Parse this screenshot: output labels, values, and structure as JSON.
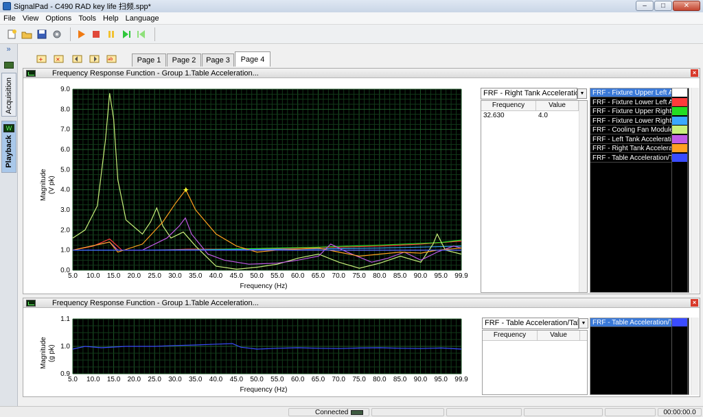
{
  "window": {
    "title": "SignalPad - C490 RAD key life 扫频.spp*",
    "min": "–",
    "max": "□",
    "close": "✕"
  },
  "menu": [
    "File",
    "View",
    "Options",
    "Tools",
    "Help",
    "Language"
  ],
  "toolbar": {
    "icons": [
      "new-icon",
      "open-icon",
      "save-icon",
      "settings-icon",
      "play-icon",
      "stop-icon",
      "pause-icon",
      "step-forward-icon",
      "step-back-icon"
    ]
  },
  "sidebar": {
    "chevron": "»",
    "tabs": [
      {
        "label": "Acquisition",
        "active": false
      },
      {
        "label": "Playback",
        "active": true
      }
    ]
  },
  "page_tabs": [
    "Page 1",
    "Page 2",
    "Page 3",
    "Page 4"
  ],
  "active_page": "Page 4",
  "panels": [
    {
      "title": "Frequency Response Function - Group 1.Table Acceleration...",
      "xlabel": "Frequency (Hz)",
      "ylabel": "Magnitude",
      "yunit": "(V pk)",
      "selector": "FRF - Right Tank Acceleration/",
      "table": {
        "headers": [
          "Frequency",
          "Value"
        ],
        "rows": [
          [
            "32.630",
            "4.0"
          ]
        ]
      },
      "legend": [
        {
          "label": "FRF - Fixture Upper Left A",
          "color": "#ffffff",
          "selected": true
        },
        {
          "label": "FRF - Fixture Lower Left A",
          "color": "#ff3b3b"
        },
        {
          "label": "FRF - Fixture Upper Right A",
          "color": "#22dd22"
        },
        {
          "label": "FRF - Fixture Lower Right",
          "color": "#3aa8ff"
        },
        {
          "label": "FRF - Cooling Fan Module A",
          "color": "#c8f07a"
        },
        {
          "label": "FRF - Left Tank Acceleratio",
          "color": "#c05ae6"
        },
        {
          "label": "FRF - Right Tank Accelerati",
          "color": "#ffa020"
        },
        {
          "label": "FRF - Table Acceleration/T",
          "color": "#3a4cff"
        }
      ]
    },
    {
      "title": "Frequency Response Function - Group 1.Table Acceleration...",
      "xlabel": "Frequency (Hz)",
      "ylabel": "Magnitude",
      "yunit": "(g pk)",
      "selector": "FRF - Table Acceleration/Table",
      "table": {
        "headers": [
          "Frequency",
          "Value"
        ],
        "rows": []
      },
      "legend": [
        {
          "label": "FRF - Table Acceleration/T",
          "color": "#3a4cff",
          "selected": true
        }
      ]
    }
  ],
  "status": {
    "connection": "Connected",
    "time": "00:00:00.0"
  },
  "chart_data": [
    {
      "type": "line",
      "xlabel": "Frequency (Hz)",
      "ylabel": "Magnitude (V pk)",
      "x_ticks": [
        "5.0",
        "10.0",
        "15.0",
        "20.0",
        "25.0",
        "30.0",
        "35.0",
        "40.0",
        "45.0",
        "50.0",
        "55.0",
        "60.0",
        "65.0",
        "70.0",
        "75.0",
        "80.0",
        "85.0",
        "90.0",
        "95.0",
        "99.9"
      ],
      "y_ticks": [
        "0.0",
        "1.0",
        "2.0",
        "3.0",
        "4.0",
        "5.0",
        "6.0",
        "7.0",
        "8.0",
        "9.0"
      ],
      "xlim": [
        5.0,
        99.9
      ],
      "ylim": [
        0,
        9
      ],
      "grid": true,
      "marker": {
        "x": 32.63,
        "y": 4.0
      },
      "series": [
        {
          "name": "FRF - Fixture Upper Left A",
          "color": "#ffffff",
          "x": [
            5,
            15,
            25,
            35,
            45,
            55,
            65,
            75,
            85,
            95,
            99.9
          ],
          "y": [
            1.0,
            1.0,
            1.0,
            1.0,
            1.0,
            1.0,
            1.0,
            1.0,
            1.0,
            1.0,
            1.0
          ]
        },
        {
          "name": "FRF - Fixture Lower Left A",
          "color": "#ff3b3b",
          "x": [
            5,
            10,
            14,
            17,
            25,
            33,
            40,
            50,
            60,
            70,
            80,
            90,
            99.9
          ],
          "y": [
            1.0,
            1.2,
            1.55,
            1.0,
            1.0,
            1.05,
            1.05,
            1.05,
            1.1,
            1.15,
            1.2,
            1.3,
            1.45
          ]
        },
        {
          "name": "FRF - Fixture Upper Right A",
          "color": "#22dd22",
          "x": [
            5,
            20,
            35,
            50,
            65,
            80,
            95,
            99.9
          ],
          "y": [
            1.0,
            1.0,
            1.02,
            1.08,
            1.15,
            1.25,
            1.38,
            1.5
          ]
        },
        {
          "name": "FRF - Fixture Lower Right",
          "color": "#3aa8ff",
          "x": [
            5,
            20,
            40,
            60,
            80,
            99.9
          ],
          "y": [
            1.0,
            1.0,
            1.02,
            1.05,
            1.1,
            1.2
          ]
        },
        {
          "name": "FRF - Cooling Fan Module A",
          "color": "#c8f07a",
          "x": [
            5,
            8,
            11,
            13,
            14,
            15,
            16,
            18,
            22,
            24,
            25.5,
            27,
            29,
            32,
            35,
            40,
            45,
            50,
            55,
            60,
            65,
            70,
            75,
            80,
            85,
            90,
            93,
            94,
            96,
            99.9
          ],
          "y": [
            1.6,
            2.0,
            3.2,
            6.5,
            8.8,
            7.5,
            4.5,
            2.5,
            1.8,
            2.4,
            3.1,
            2.2,
            1.6,
            1.9,
            1.2,
            0.2,
            0.05,
            0.15,
            0.3,
            0.6,
            0.8,
            0.4,
            0.1,
            0.35,
            0.7,
            0.4,
            1.3,
            1.8,
            1.0,
            0.8
          ]
        },
        {
          "name": "FRF - Left Tank Acceleratio",
          "color": "#c05ae6",
          "x": [
            5,
            14,
            16,
            22,
            28,
            31,
            32.5,
            34,
            38,
            42,
            48,
            55,
            60,
            65,
            68,
            72,
            78,
            82,
            86,
            90,
            94,
            98,
            99.9
          ],
          "y": [
            1.0,
            1.4,
            1.0,
            1.0,
            1.6,
            2.2,
            2.6,
            1.8,
            0.8,
            0.5,
            0.3,
            0.35,
            0.5,
            0.7,
            1.3,
            0.9,
            0.4,
            0.6,
            0.9,
            0.5,
            0.9,
            1.2,
            1.1
          ]
        },
        {
          "name": "FRF - Right Tank Accelerati",
          "color": "#ffa020",
          "x": [
            5,
            14,
            16,
            22,
            27,
            30,
            32.6,
            35,
            40,
            45,
            50,
            55,
            60,
            65,
            70,
            75,
            80,
            85,
            90,
            94,
            97,
            99.9
          ],
          "y": [
            1.0,
            1.4,
            0.9,
            1.3,
            2.4,
            3.3,
            4.0,
            3.0,
            1.8,
            1.2,
            0.9,
            1.0,
            1.05,
            1.1,
            0.9,
            0.7,
            0.8,
            0.9,
            0.85,
            1.0,
            1.05,
            1.1
          ]
        },
        {
          "name": "FRF - Table Acceleration/T",
          "color": "#3a4cff",
          "x": [
            5,
            30,
            60,
            99.9
          ],
          "y": [
            1.0,
            1.0,
            1.0,
            1.0
          ]
        }
      ]
    },
    {
      "type": "line",
      "xlabel": "Frequency (Hz)",
      "ylabel": "Magnitude (g pk)",
      "x_ticks": [
        "5.0",
        "10.0",
        "15.0",
        "20.0",
        "25.0",
        "30.0",
        "35.0",
        "40.0",
        "45.0",
        "50.0",
        "55.0",
        "60.0",
        "65.0",
        "70.0",
        "75.0",
        "80.0",
        "85.0",
        "90.0",
        "95.0",
        "99.9"
      ],
      "y_ticks": [
        "0.9",
        "1.0",
        "1.1"
      ],
      "xlim": [
        5.0,
        99.9
      ],
      "ylim": [
        0.9,
        1.1
      ],
      "grid": true,
      "series": [
        {
          "name": "FRF - Table Acceleration/T",
          "color": "#3a4cff",
          "x": [
            5,
            8,
            12,
            18,
            25,
            30,
            35,
            40,
            44,
            46,
            50,
            55,
            60,
            65,
            70,
            75,
            80,
            85,
            90,
            95,
            99.9
          ],
          "y": [
            0.99,
            1.0,
            0.995,
            1.0,
            1.0,
            1.003,
            1.005,
            1.008,
            1.01,
            0.997,
            0.99,
            0.993,
            0.995,
            0.993,
            0.992,
            0.994,
            0.995,
            0.993,
            0.992,
            0.994,
            0.99
          ]
        }
      ]
    }
  ]
}
